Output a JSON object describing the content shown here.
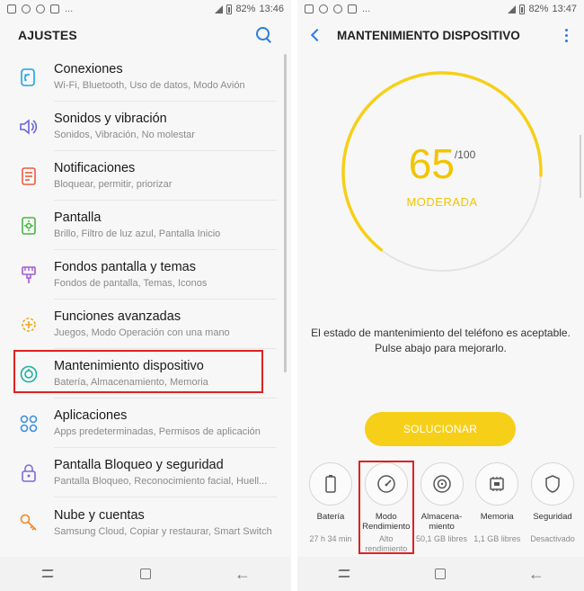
{
  "left_screen": {
    "status": {
      "battery": "82%",
      "time": "13:46",
      "dots": "..."
    },
    "title": "AJUSTES",
    "items": [
      {
        "title": "Conexiones",
        "subtitle": "Wi-Fi, Bluetooth, Uso de datos, Modo Avión",
        "icon": "wifi-icon",
        "color": "#1aa3e8"
      },
      {
        "title": "Sonidos y vibración",
        "subtitle": "Sonidos, Vibración, No molestar",
        "icon": "speaker-icon",
        "color": "#6b63d9"
      },
      {
        "title": "Notificaciones",
        "subtitle": "Bloquear, permitir, priorizar",
        "icon": "notification-icon",
        "color": "#ef5b3f"
      },
      {
        "title": "Pantalla",
        "subtitle": "Brillo, Filtro de luz azul, Pantalla Inicio",
        "icon": "display-icon",
        "color": "#4bb543"
      },
      {
        "title": "Fondos pantalla y temas",
        "subtitle": "Fondos de pantalla, Temas, Iconos",
        "icon": "brush-icon",
        "color": "#a45bd6"
      },
      {
        "title": "Funciones avanzadas",
        "subtitle": "Juegos, Modo Operación con una mano",
        "icon": "gear-plus-icon",
        "color": "#f2a81a"
      },
      {
        "title": "Mantenimiento dispositivo",
        "subtitle": "Batería, Almacenamiento, Memoria",
        "icon": "maintenance-icon",
        "color": "#1cb0a3"
      },
      {
        "title": "Aplicaciones",
        "subtitle": "Apps predeterminadas, Permisos de aplicación",
        "icon": "apps-icon",
        "color": "#3d8fe0"
      },
      {
        "title": "Pantalla Bloqueo y seguridad",
        "subtitle": "Pantalla Bloqueo, Reconocimiento facial, Huell...",
        "icon": "lock-icon",
        "color": "#7d6bd4"
      },
      {
        "title": "Nube y cuentas",
        "subtitle": "Samsung Cloud, Copiar y restaurar, Smart Switch",
        "icon": "key-icon",
        "color": "#f08a24"
      }
    ]
  },
  "right_screen": {
    "status": {
      "battery": "82%",
      "time": "13:47",
      "dots": "..."
    },
    "title": "MANTENIMIENTO DISPOSITIVO",
    "score": "65",
    "score_max": "/100",
    "score_level": 0.65,
    "state": "MODERADA",
    "message_line1": "El estado de mantenimiento del teléfono es aceptable.",
    "message_line2": "Pulse abajo para mejorarlo.",
    "fix_button": "SOLUCIONAR",
    "tools": [
      {
        "label": "Batería",
        "value": "27 h 34 min",
        "icon": "battery-icon"
      },
      {
        "label": "Modo\nRendimiento",
        "value": "Alto\nrendimiento",
        "icon": "speedometer-icon"
      },
      {
        "label": "Almacena-\nmiento",
        "value": "50,1 GB libres",
        "icon": "storage-icon"
      },
      {
        "label": "Memoria",
        "value": "1,1 GB libres",
        "icon": "memory-chip-icon"
      },
      {
        "label": "Seguridad",
        "value": "Desactivado",
        "icon": "shield-icon"
      }
    ]
  },
  "colors": {
    "accent": "#2b7de1",
    "gauge": "#f6cf19",
    "highlight": "#e02020"
  }
}
